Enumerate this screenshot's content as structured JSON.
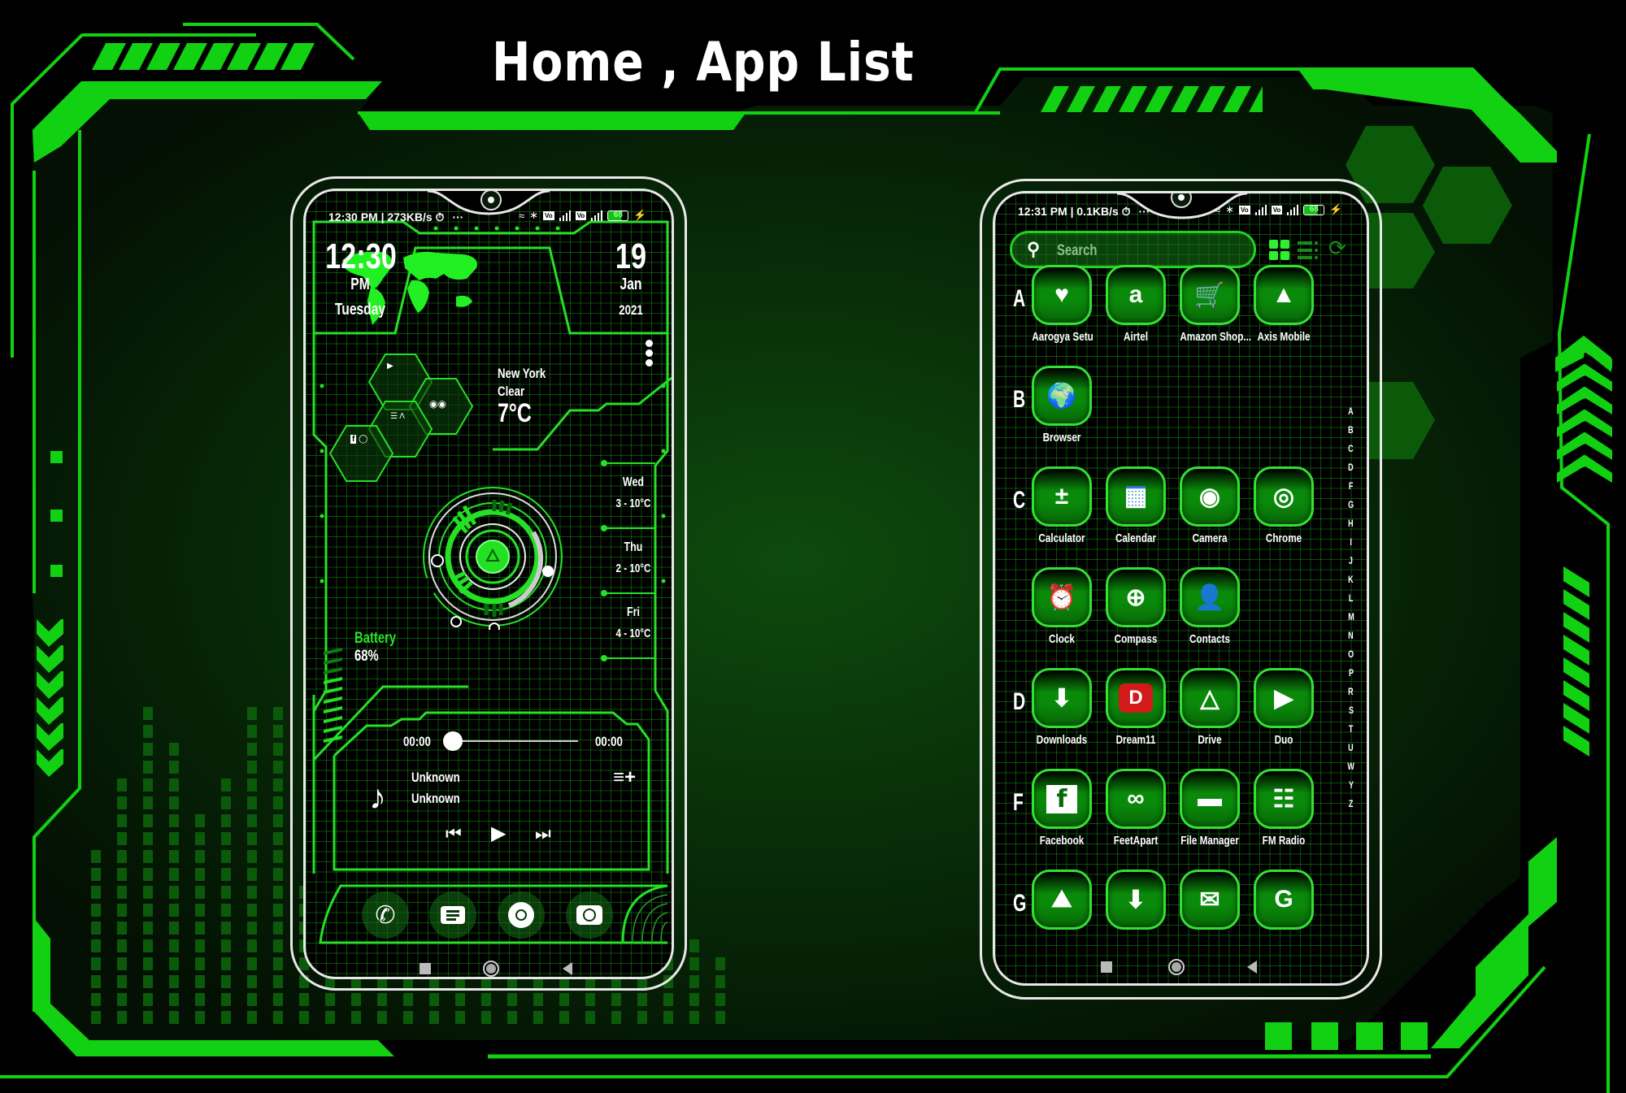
{
  "page_title": "Home , App List",
  "colors": {
    "accent": "#16d016",
    "bright": "#26e026",
    "bg_dark": "#031003"
  },
  "home_screen": {
    "status_bar": {
      "left": "12:30 PM | 273KB/s",
      "alarm_icon": "alarm-icon",
      "overflow": "···",
      "battery": "68"
    },
    "clock": {
      "time": "12:30",
      "ampm": "PM",
      "day": "Tuesday"
    },
    "date": {
      "day": "19",
      "month": "Jan",
      "year": "2021"
    },
    "weather": {
      "city": "New York",
      "condition": "Clear",
      "temp": "7°C"
    },
    "forecast": [
      {
        "day": "Wed",
        "range": "3 - 10°C"
      },
      {
        "day": "Thu",
        "range": "2 - 10°C"
      },
      {
        "day": "Fri",
        "range": "4 - 10°C"
      }
    ],
    "battery": {
      "label": "Battery",
      "value": "68%",
      "percent": 68
    },
    "music": {
      "elapsed": "00:00",
      "total": "00:00",
      "progress": 0,
      "title": "Unknown",
      "artist": "Unknown"
    },
    "dock": [
      {
        "name": "phone-icon"
      },
      {
        "name": "messages-icon"
      },
      {
        "name": "chrome-icon"
      },
      {
        "name": "camera-icon"
      }
    ]
  },
  "app_list": {
    "status_bar": {
      "left": "12:31 PM | 0.1KB/s",
      "overflow": "···",
      "battery": "68"
    },
    "search_placeholder": "Search",
    "sections": [
      {
        "letter": "A",
        "apps": [
          "Aarogya Setu",
          "Airtel",
          "Amazon Shop...",
          "Axis Mobile"
        ]
      },
      {
        "letter": "B",
        "apps": [
          "Browser"
        ]
      },
      {
        "letter": "C",
        "apps": [
          "Calculator",
          "Calendar",
          "Camera",
          "Chrome",
          "Clock",
          "Compass",
          "Contacts"
        ]
      },
      {
        "letter": "D",
        "apps": [
          "Downloads",
          "Dream11",
          "Drive",
          "Duo"
        ]
      },
      {
        "letter": "F",
        "apps": [
          "Facebook",
          "FeetApart",
          "File Manager",
          "FM Radio"
        ]
      },
      {
        "letter": "G",
        "apps": [
          "",
          "",
          "",
          ""
        ]
      }
    ],
    "alphabet_index": [
      "A",
      "B",
      "C",
      "D",
      "F",
      "G",
      "H",
      "I",
      "J",
      "K",
      "L",
      "M",
      "N",
      "O",
      "P",
      "R",
      "S",
      "T",
      "U",
      "W",
      "Y",
      "Z"
    ]
  }
}
